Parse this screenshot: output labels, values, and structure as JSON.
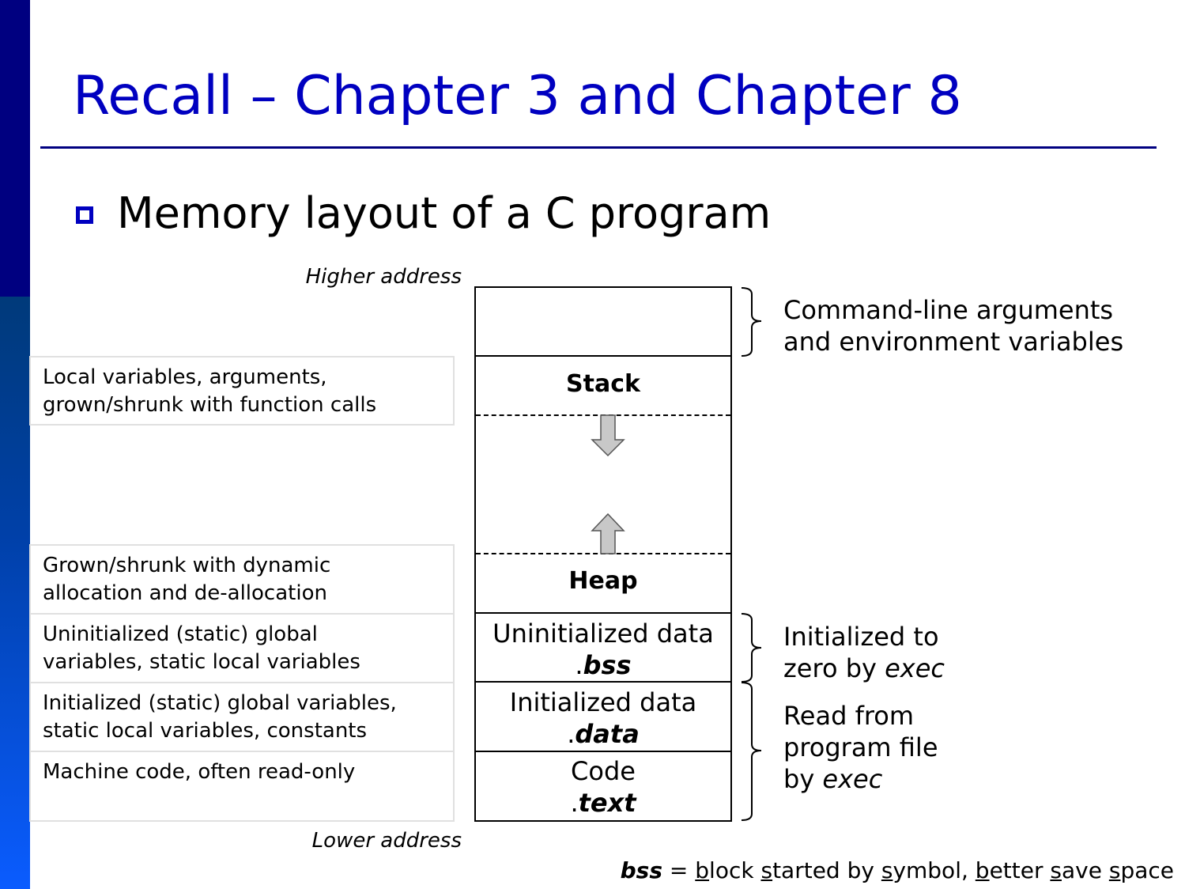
{
  "slide": {
    "title": "Recall – Chapter 3 and Chapter 8",
    "bullet": "Memory layout of a C program",
    "colors": {
      "title": "#0000c0",
      "sidebar_dark": "#000080",
      "sidebar_gradient_bottom": "#0a5cff",
      "arrow_fill": "#c8c8c8"
    }
  },
  "diagram": {
    "higher_address": "Higher address",
    "lower_address": "Lower address",
    "segments": {
      "args_env": "",
      "stack": "Stack",
      "heap": "Heap",
      "bss": {
        "line1": "Uninitialized data",
        "dot": ".",
        "name": "bss"
      },
      "data": {
        "line1": "Initialized data",
        "dot": ".",
        "name": "data"
      },
      "text": {
        "line1": "Code",
        "dot": ".",
        "name": "text"
      }
    },
    "arrows": {
      "stack_direction": "down",
      "heap_direction": "up"
    },
    "descriptions": [
      {
        "line1": "Local variables, arguments,",
        "line2": "grown/shrunk with function calls"
      },
      {
        "line1": "Grown/shrunk with dynamic",
        "line2": "allocation and de-allocation"
      },
      {
        "line1": "Uninitialized (static) global",
        "line2": "variables, static local variables"
      },
      {
        "line1": "Initialized (static) global variables,",
        "line2": "static local variables, constants"
      },
      {
        "line1": "Machine code, often read-only",
        "line2": ""
      }
    ],
    "notes": {
      "args_env": {
        "line1": "Command-line arguments",
        "line2": "and environment variables"
      },
      "bss_zero": {
        "line1": "Initialized to",
        "line2_prefix": "zero by ",
        "line2_italic": "exec"
      },
      "read_file": {
        "line1": "Read from",
        "line2": "program file",
        "line3_prefix": "by ",
        "line3_italic": "exec"
      }
    }
  },
  "footnote": {
    "term": "bss",
    "equals": " = ",
    "parts": [
      {
        "u": "b",
        "t": "lock "
      },
      {
        "u": "s",
        "t": "tarted by "
      },
      {
        "u": "s",
        "t": "ymbol, "
      },
      {
        "u": "b",
        "t": "etter "
      },
      {
        "u": "s",
        "t": "ave "
      },
      {
        "u": "s",
        "t": "pace"
      }
    ]
  }
}
